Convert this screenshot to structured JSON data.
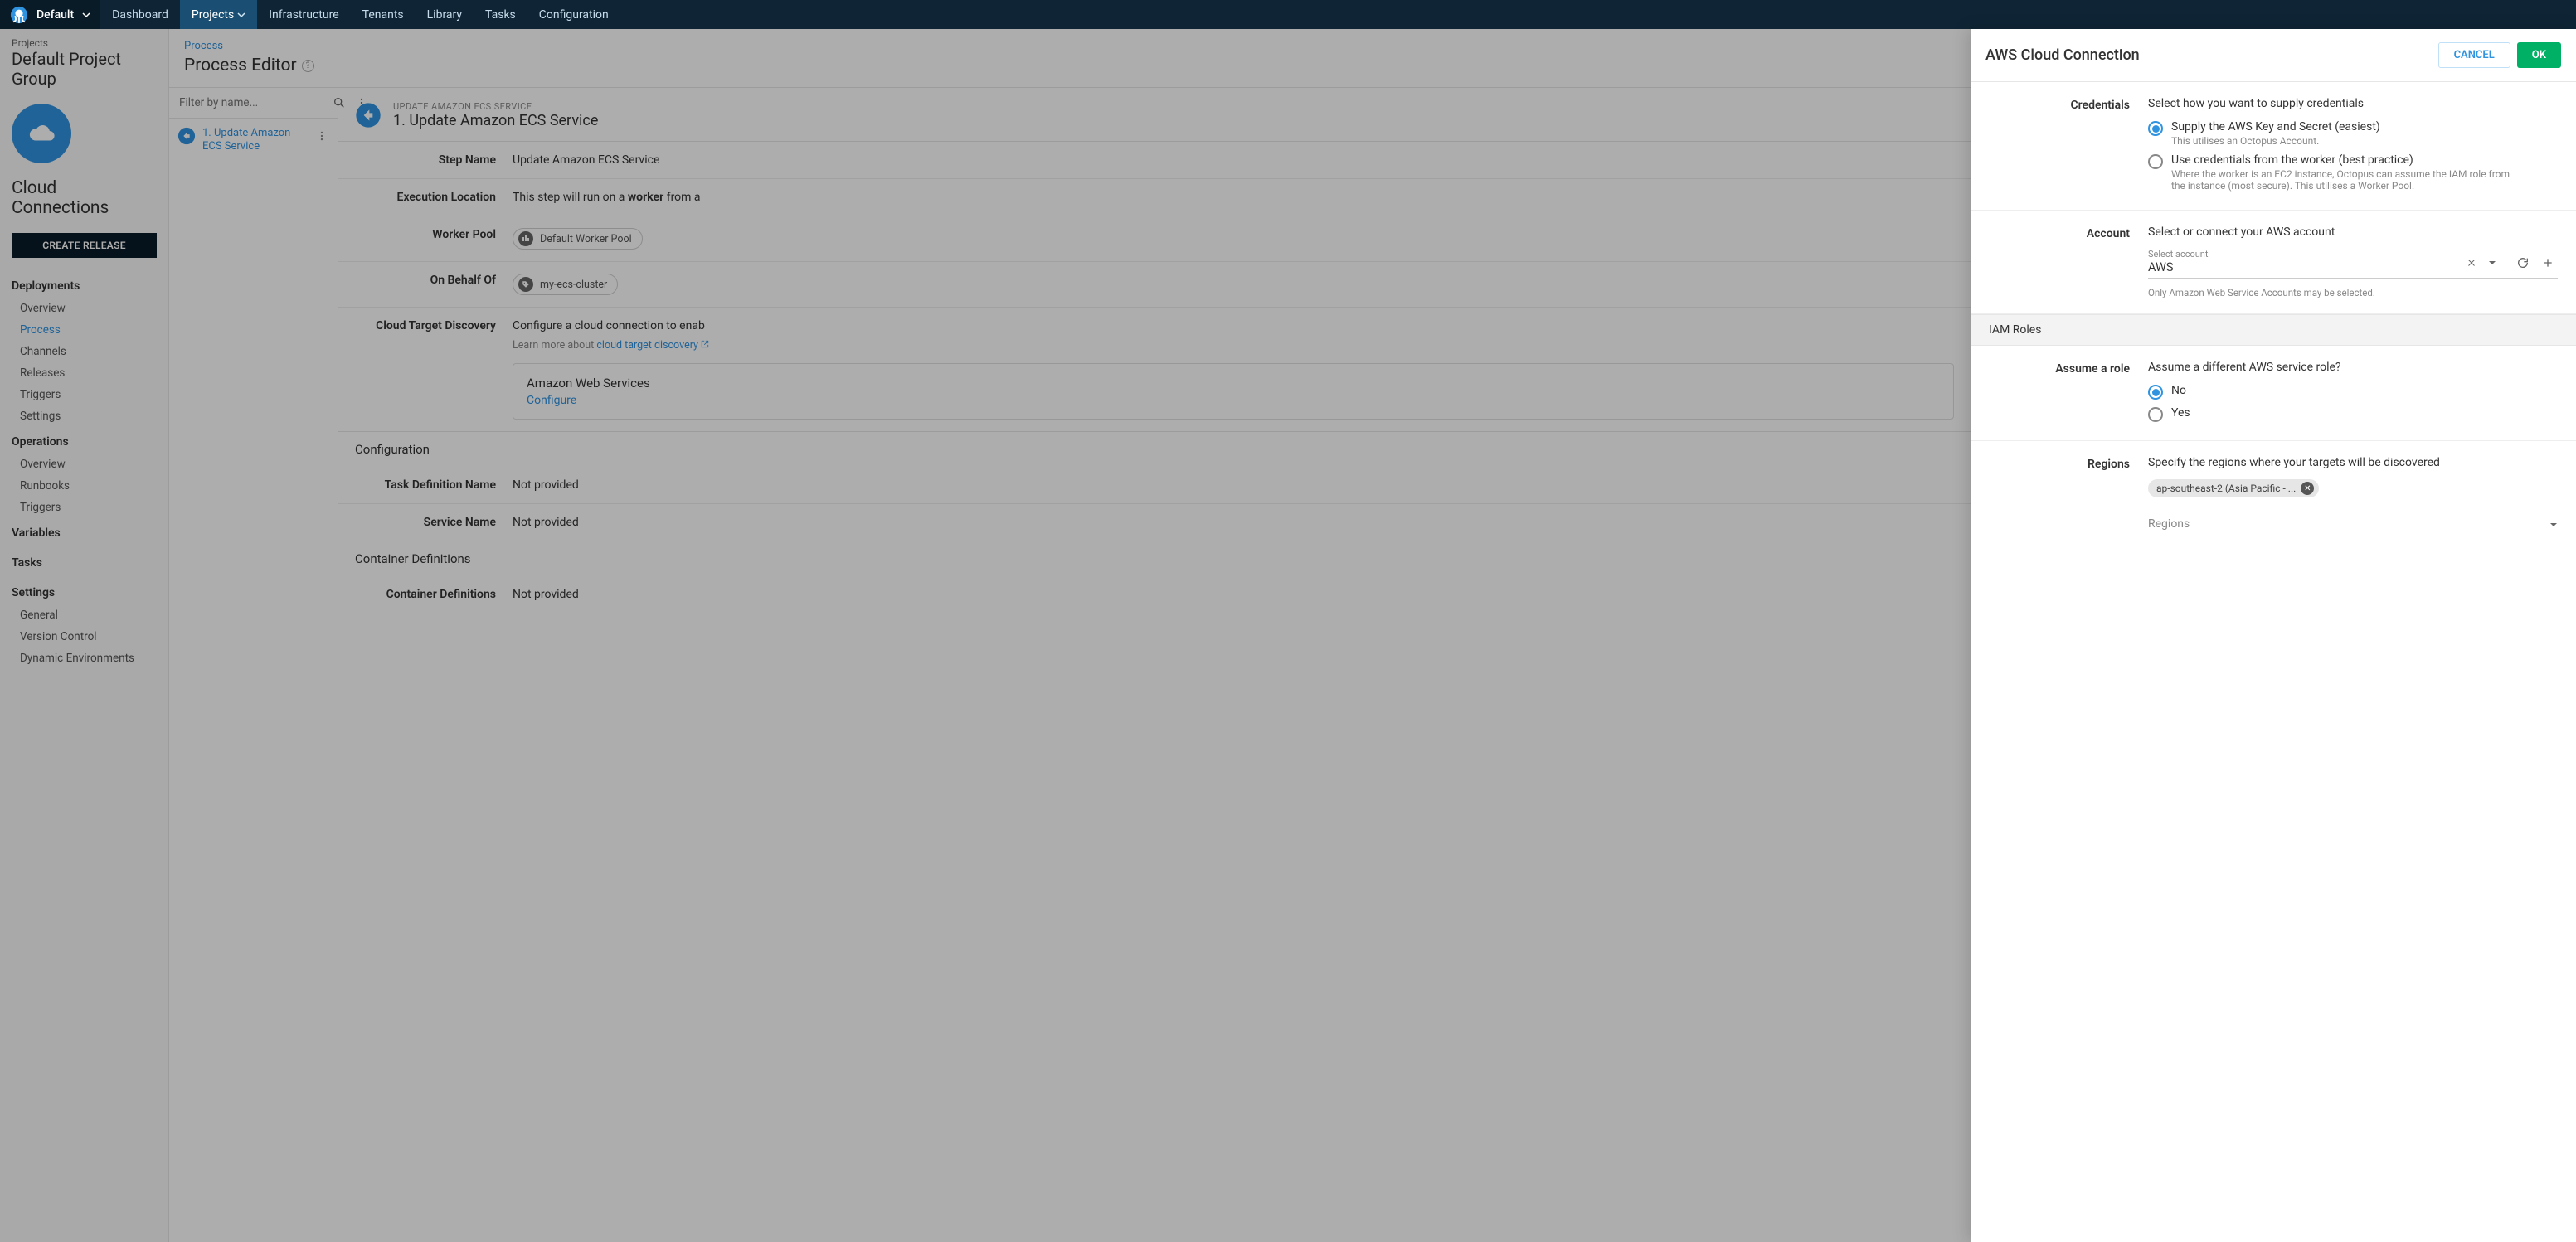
{
  "space": {
    "name": "Default"
  },
  "topnav": {
    "dashboard": "Dashboard",
    "projects": "Projects",
    "infrastructure": "Infrastructure",
    "tenants": "Tenants",
    "library": "Library",
    "tasks": "Tasks",
    "configuration": "Configuration"
  },
  "project": {
    "breadcrumb": "Projects",
    "group": "Default Project Group",
    "name": "Cloud Connections",
    "create_release": "CREATE RELEASE"
  },
  "sidenav": {
    "deployments": {
      "hdr": "Deployments",
      "overview": "Overview",
      "process": "Process",
      "channels": "Channels",
      "releases": "Releases",
      "triggers": "Triggers",
      "settings": "Settings"
    },
    "operations": {
      "hdr": "Operations",
      "overview": "Overview",
      "runbooks": "Runbooks",
      "triggers": "Triggers"
    },
    "variables": "Variables",
    "tasks": "Tasks",
    "settings": {
      "hdr": "Settings",
      "general": "General",
      "version_control": "Version Control",
      "dynamic_env": "Dynamic Environments"
    }
  },
  "proc": {
    "crumb": "Process",
    "title": "Process Editor",
    "filter_placeholder": "Filter by name...",
    "step1_num": "1.",
    "step1_name": "Update Amazon ECS Service"
  },
  "detail": {
    "sub": "UPDATE AMAZON ECS SERVICE",
    "title": "1. Update Amazon ECS Service",
    "step_name_k": "Step Name",
    "step_name_v": "Update Amazon ECS Service",
    "exec_k": "Execution Location",
    "exec_v_pre": "This step will run on a ",
    "exec_v_b": "worker",
    "exec_v_post": " from a",
    "wp_k": "Worker Pool",
    "wp_chip": "Default Worker Pool",
    "behalf_k": "On Behalf Of",
    "behalf_chip": "my-ecs-cluster",
    "ctd_k": "Cloud Target Discovery",
    "ctd_v": "Configure a cloud connection to enab",
    "ctd_hint_pre": "Learn more about ",
    "ctd_link": "cloud target discovery",
    "aws_card_title": "Amazon Web Services",
    "aws_card_link": "Configure",
    "cfg_hdr": "Configuration",
    "tdn_k": "Task Definition Name",
    "tdn_v": "Not provided",
    "svc_k": "Service Name",
    "svc_v": "Not provided",
    "cd_hdr": "Container Definitions",
    "cd_k": "Container Definitions",
    "cd_v": "Not provided"
  },
  "drawer": {
    "title": "AWS Cloud Connection",
    "cancel": "CANCEL",
    "ok": "OK",
    "cred_k": "Credentials",
    "cred_lead": "Select how you want to supply credentials",
    "cred_opt1": "Supply the AWS Key and Secret (easiest)",
    "cred_opt1_help": "This utilises an Octopus Account.",
    "cred_opt2": "Use credentials from the worker (best practice)",
    "cred_opt2_help": "Where the worker is an EC2 instance, Octopus can assume the IAM role from the instance (most secure). This utilises a Worker Pool.",
    "acct_k": "Account",
    "acct_lead": "Select or connect your AWS account",
    "acct_float": "Select account",
    "acct_val": "AWS",
    "acct_hint": "Only Amazon Web Service Accounts may be selected.",
    "iam_hdr": "IAM Roles",
    "assume_k": "Assume a role",
    "assume_lead": "Assume a different AWS service role?",
    "assume_no": "No",
    "assume_yes": "Yes",
    "regions_k": "Regions",
    "regions_lead": "Specify the regions where your targets will be discovered",
    "region_chip": "ap-southeast-2 (Asia Pacific - ...",
    "regions_placeholder": "Regions"
  }
}
